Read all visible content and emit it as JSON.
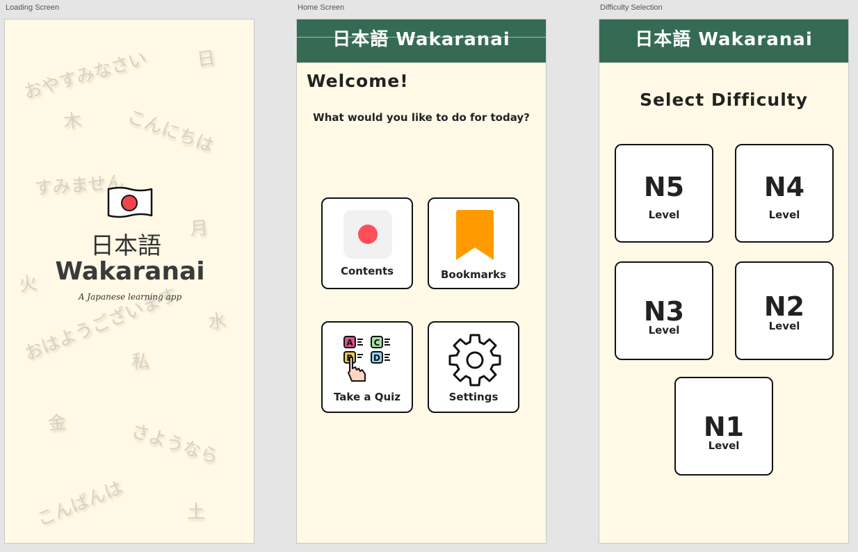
{
  "artboards": {
    "loading": "Loading Screen",
    "home": "Home Screen",
    "difficulty": "Difficulty Selection"
  },
  "app_name_jp": "日本語",
  "app_name_en": "Wakaranai",
  "header_title": "日本語 Wakaranai",
  "loading": {
    "tagline": "A Japanese learning app",
    "background_words": [
      "おやすみなさい",
      "日",
      "木",
      "こんにちは",
      "すみません",
      "月",
      "火",
      "おはようございます",
      "水",
      "私",
      "金",
      "さようなら",
      "こんばんは",
      "土"
    ]
  },
  "home": {
    "welcome": "Welcome!",
    "question": "What would you like to do for today?",
    "tiles": [
      {
        "label": "Contents",
        "icon": "red-circle-icon"
      },
      {
        "label": "Bookmarks",
        "icon": "bookmark-icon"
      },
      {
        "label": "Take a Quiz",
        "icon": "quiz-icon"
      },
      {
        "label": "Settings",
        "icon": "gear-icon"
      }
    ],
    "quiz_letters": [
      "A",
      "C",
      "B",
      "D"
    ]
  },
  "difficulty": {
    "title": "Select Difficulty",
    "level_word": "Level",
    "levels": [
      "N5",
      "N4",
      "N3",
      "N2",
      "N1"
    ]
  },
  "colors": {
    "header": "#356b55",
    "screen_bg": "#fff9e6",
    "flag_red": "#f0454f",
    "bookmark_orange": "#ff9a00",
    "contents_red": "#ff4d5a"
  }
}
